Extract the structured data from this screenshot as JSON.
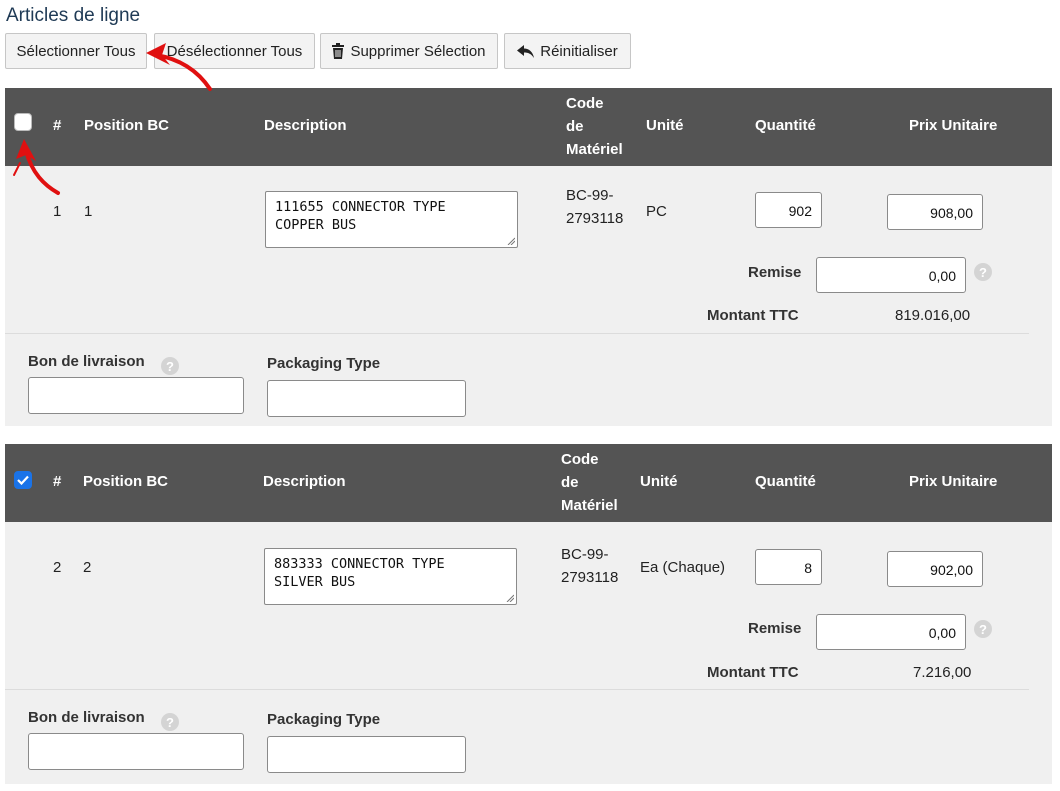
{
  "section_title": "Articles de ligne",
  "toolbar": {
    "select_all": "Sélectionner Tous",
    "deselect_all": "Désélectionner Tous",
    "delete_selection": "Supprimer Sélection",
    "reset": "Réinitialiser"
  },
  "columns": {
    "num": "#",
    "po_position": "Position BC",
    "description": "Description",
    "material_code_1": "Code",
    "material_code_2": "de",
    "material_code_3": "Matériel",
    "unit": "Unité",
    "quantity": "Quantité",
    "unit_price": "Prix Unitaire"
  },
  "labels": {
    "discount": "Remise",
    "amount_ttc": "Montant TTC",
    "delivery_note": "Bon de livraison",
    "packaging_type": "Packaging Type",
    "help": "?"
  },
  "items": [
    {
      "checked": false,
      "num": "1",
      "po_position": "1",
      "description": "111655 CONNECTOR TYPE\nCOPPER BUS",
      "material_code_1": "BC-99-",
      "material_code_2": "2793118",
      "unit": "PC",
      "quantity": "902",
      "unit_price": "908,00",
      "discount": "0,00",
      "amount_ttc": "819.016,00",
      "delivery_note": "",
      "packaging_type": ""
    },
    {
      "checked": true,
      "num": "2",
      "po_position": "2",
      "description": "883333 CONNECTOR TYPE\nSILVER BUS",
      "material_code_1": "BC-99-",
      "material_code_2": "2793118",
      "unit": "Ea (Chaque)",
      "quantity": "8",
      "unit_price": "902,00",
      "discount": "0,00",
      "amount_ttc": "7.216,00",
      "delivery_note": "",
      "packaging_type": ""
    }
  ],
  "colors": {
    "header_bg": "#545454",
    "body_bg": "#f0f0f0",
    "title": "#1f3a55",
    "annotation_arrow": "#e01010",
    "checkbox_checked": "#1a73e8"
  }
}
